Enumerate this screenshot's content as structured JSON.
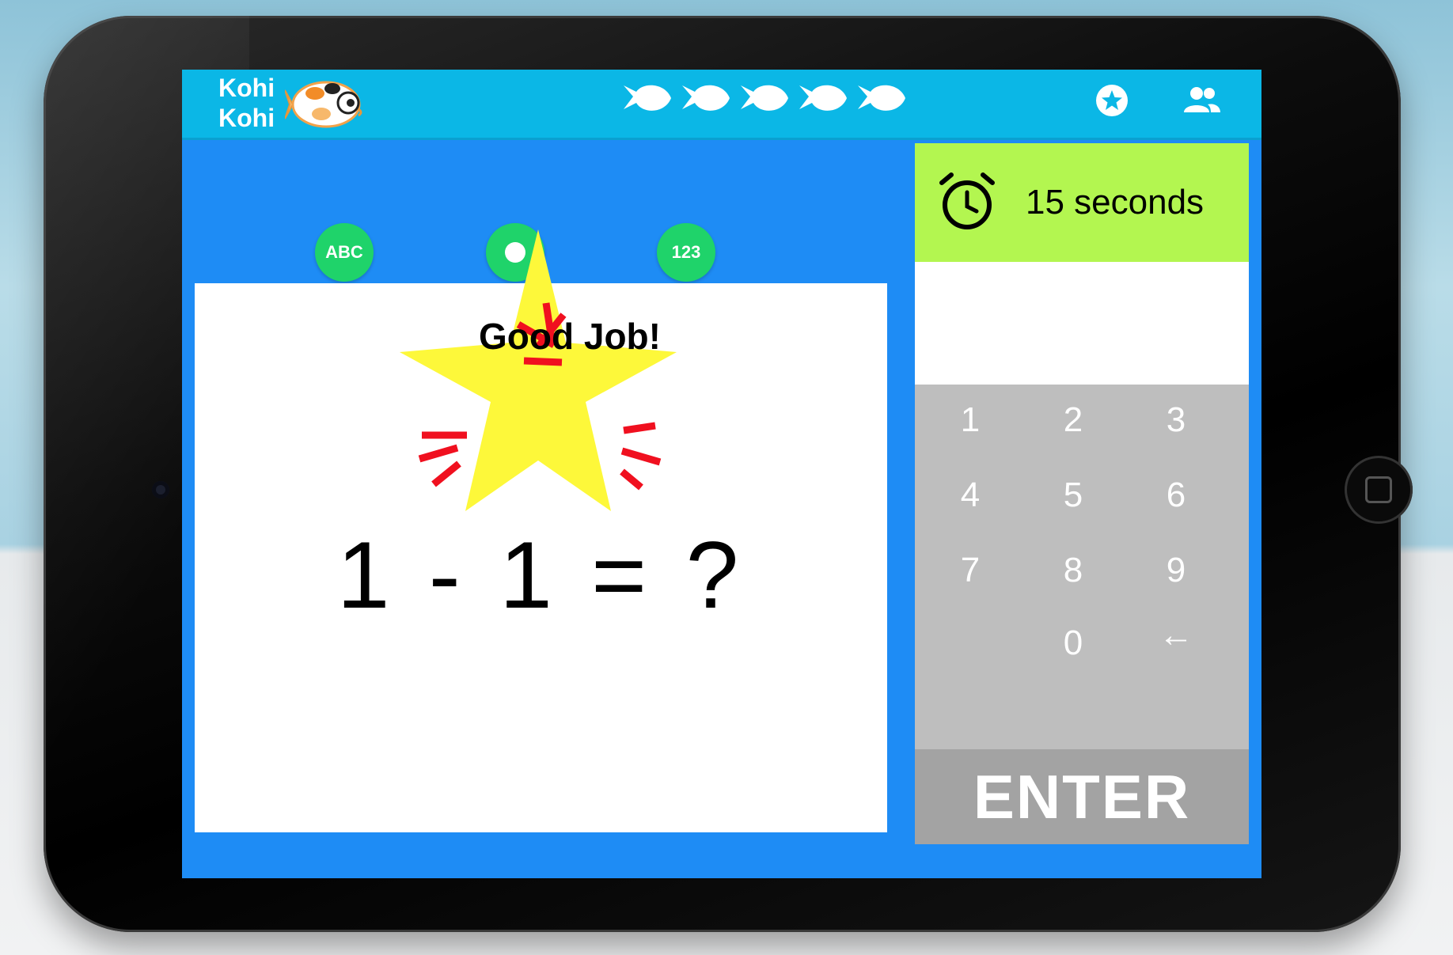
{
  "app": {
    "logo_line1": "Kohi",
    "logo_line2": "Kohi",
    "icons": {
      "logo": "koi-fish-logo-icon",
      "progress": "fish-icon",
      "favorites": "star-circle-icon",
      "profile": "users-icon",
      "timer": "alarm-clock-icon",
      "home": "home-button"
    },
    "progress_fish_count": 5
  },
  "modes": {
    "letters": "ABC",
    "numbers": "123"
  },
  "question": {
    "equation": "1 - 1 = ?"
  },
  "feedback": {
    "message": "Good Job!"
  },
  "timer": {
    "text": "15 seconds"
  },
  "answer": {
    "value": ""
  },
  "keypad": {
    "keys": [
      "1",
      "2",
      "3",
      "4",
      "5",
      "6",
      "7",
      "8",
      "9",
      "0",
      "←"
    ],
    "enter_label": "ENTER"
  },
  "colors": {
    "screen_bg": "#1e8cf5",
    "topbar": "#0bb7e6",
    "mode_button": "#1fd36a",
    "timer_bg": "#b3f650",
    "keypad_bg": "#bebebe",
    "enter_bg": "#a3a3a3",
    "star": "#fdf83a",
    "burst_lines": "#f0101f"
  }
}
